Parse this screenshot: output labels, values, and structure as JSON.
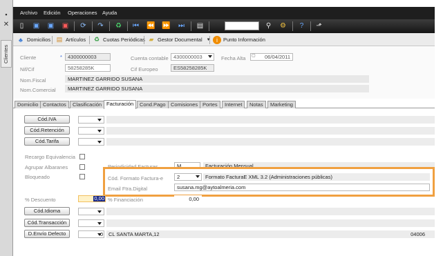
{
  "side": {
    "tab_label": "Clientes"
  },
  "menu": [
    "Archivo",
    "Edición",
    "Operaciones",
    "Ayuda"
  ],
  "linkbar": [
    {
      "label": "Domicilios",
      "icon": "people-icon",
      "color": "#3a7bd5"
    },
    {
      "label": "Artículos",
      "icon": "book-icon",
      "color": "#d08a2a"
    },
    {
      "label": "Cuotas Periódicas",
      "icon": "recycle-icon",
      "color": "#2a9a3a"
    },
    {
      "label": "Gestor Documental",
      "icon": "folder-icon",
      "color": "#d4b040"
    },
    {
      "label": "Punto Información",
      "icon": "info-icon",
      "color": "#f08c00"
    }
  ],
  "header": {
    "cliente_label": "Cliente",
    "cliente_value": "4300000003",
    "cuenta_label": "Cuenta contable",
    "cuenta_value": "4300000003",
    "fecha_label": "Fecha Alta",
    "fecha_value": "06/04/2011",
    "nif_label": "Nif/Cif",
    "nif_value": "58258285K",
    "cif_eur_label": "Cif Europeo",
    "cif_eur_value": "ES58258285K",
    "nom_fiscal_label": "Nom.Fiscal",
    "nom_fiscal_value": "MARTINEZ GARRIDO SUSANA",
    "nom_comercial_label": "Nom.Comercial",
    "nom_comercial_value": "MARTINEZ GARRIDO SUSANA"
  },
  "tabs": [
    "Domicilio",
    "Contactos",
    "Clasificación",
    "Facturación",
    "Cond.Pago",
    "Comisiones",
    "Portes",
    "Internet",
    "Notas",
    "Marketing"
  ],
  "active_tab": "Facturación",
  "facturacion": {
    "cod_iva": "Cód.IVA",
    "cod_retencion": "Cód.Retención",
    "cod_tarifa": "Cód.Tarifa",
    "recargo": "Recargo Equivalencia",
    "agrupar": "Agrupar Albaranes",
    "bloqueado": "Bloqueado",
    "periodicidad_label": "Periodicidad Facturas",
    "periodicidad_code": "M",
    "periodicidad_desc": "Facturación Mensual",
    "formato_label": "Cód. Formato Factura-e",
    "formato_code": "2",
    "formato_desc": "Formato FacturaE XML 3.2 (Administraciones públicas)",
    "email_label": "Email Ftra.Digital",
    "email_value": "susana.mg@aytoalmeria.com",
    "descuento_label": "% Descuento",
    "descuento_value": "0,00",
    "financiacion_label": "% Financiación",
    "financiacion_value": "0,00",
    "cod_idioma": "Cód.Idioma",
    "cod_transaccion": "Cód.Transacción",
    "envio_defecto": "D.Envío Defecto",
    "envio_code": "0",
    "envio_address": "CL SANTA MARTA,12",
    "envio_cp": "04006"
  }
}
